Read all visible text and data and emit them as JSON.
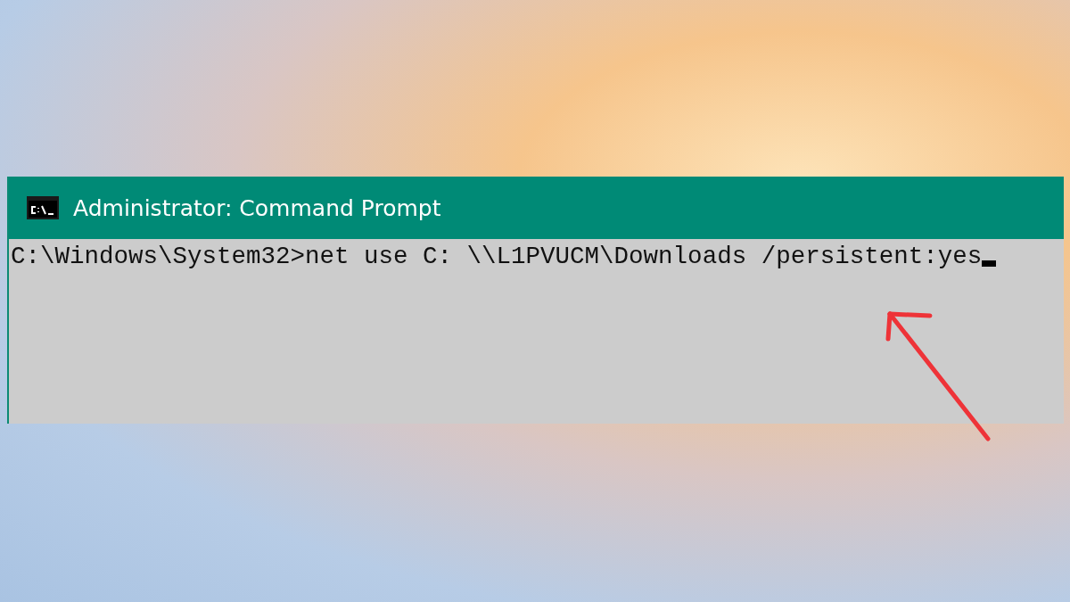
{
  "window": {
    "title": "Administrator: Command Prompt"
  },
  "console": {
    "lines": [
      "C:\\Windows\\System32>net use C: \\\\L1PVUCM\\Downloads /persistent:yes"
    ],
    "cursor": true
  }
}
